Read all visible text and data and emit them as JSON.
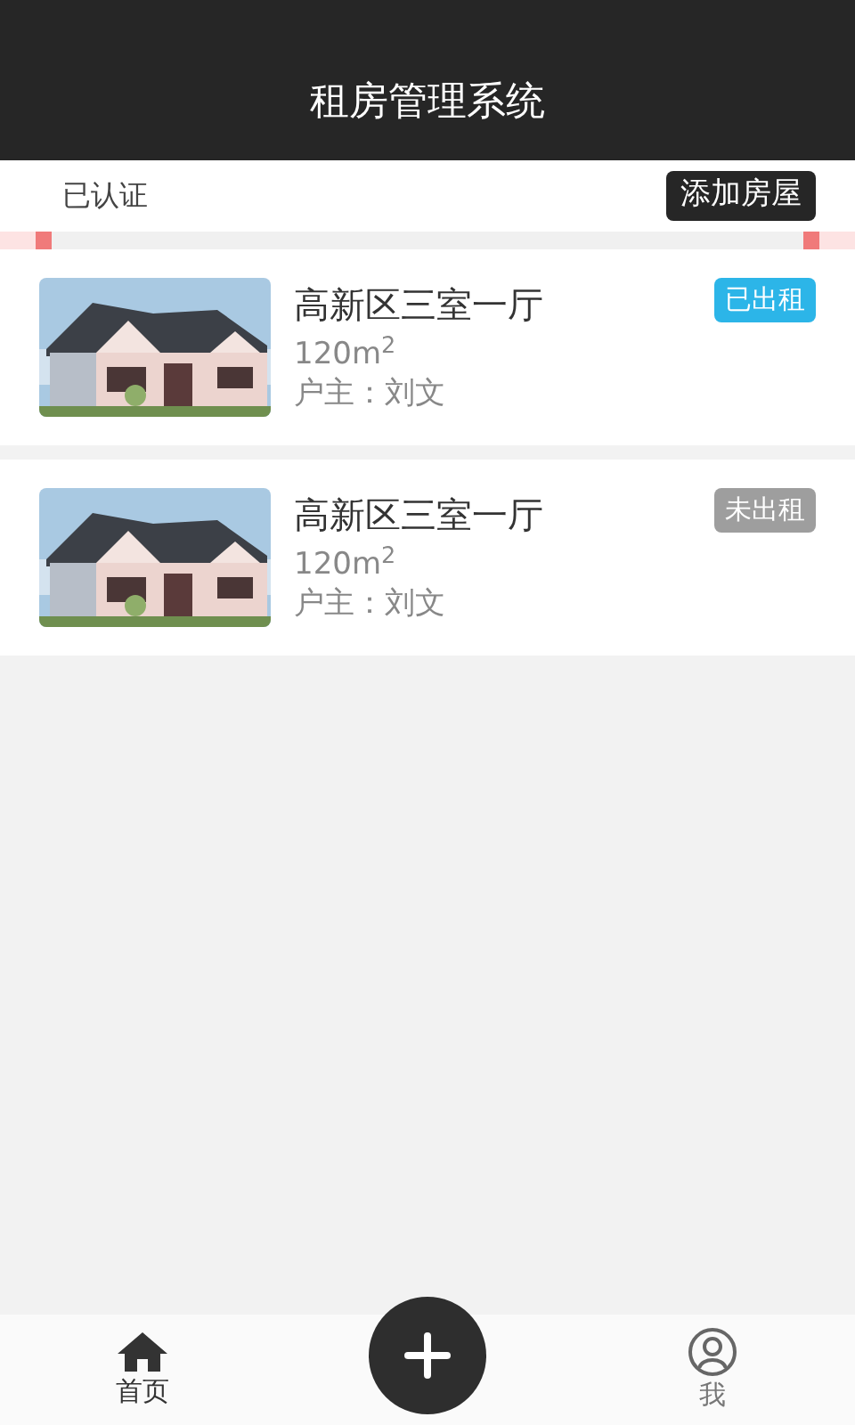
{
  "header": {
    "title": "租房管理系统"
  },
  "subbar": {
    "status": "已认证",
    "add_button": "添加房屋"
  },
  "listings": [
    {
      "kind": "picture",
      "title": "高新区三室一厅",
      "area": "120m$^{2}$",
      "owner": "户主：刘文",
      "badge": "已出租",
      "rented": true
    },
    {
      "kind": "picture",
      "title": "高新区三室一厅",
      "area": "120m$^{2}$",
      "owner": "户主：刘文",
      "badge": "未出租",
      "rented": false
    }
  ],
  "bottom_nav": [
    {
      "label": "首页",
      "kind": "home",
      "selected": true
    },
    {
      "label": "我",
      "kind": "user",
      "selected": false
    }
  ]
}
